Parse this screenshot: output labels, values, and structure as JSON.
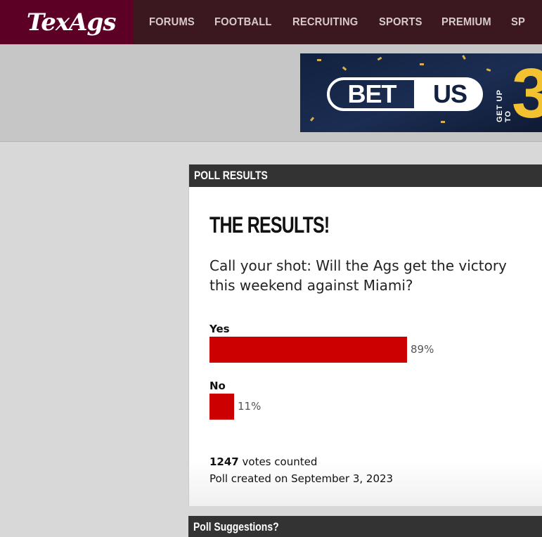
{
  "header": {
    "logo": "TexAgs",
    "nav": [
      "FORUMS",
      "FOOTBALL",
      "RECRUITING",
      "SPORTS",
      "PREMIUM",
      "SP"
    ]
  },
  "ad": {
    "brand_left": "BET",
    "brand_right": "US",
    "tagline": "GET UP TO",
    "big_number": "3"
  },
  "poll": {
    "panel_title": "POLL RESULTS",
    "heading": "THE RESULTS!",
    "question": "Call your shot: Will the Ags get the victory this weekend against Miami?",
    "options": [
      {
        "label": "Yes",
        "percent_text": "89%",
        "percent": 89
      },
      {
        "label": "No",
        "percent_text": "11%",
        "percent": 11
      }
    ],
    "votes_count": "1247",
    "votes_suffix": " votes counted",
    "created": "Poll created on September 3, 2023",
    "bar_color": "#cc0000"
  },
  "next_panel": {
    "title": "Poll Suggestions?"
  },
  "colors": {
    "brand_maroon": "#5c0025",
    "nav_bg": "#3b1820",
    "panel_header": "#333333"
  }
}
